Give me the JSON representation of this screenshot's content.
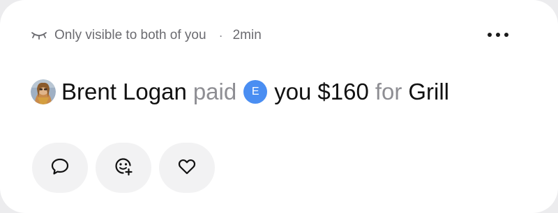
{
  "header": {
    "visibility_icon": "eye-closed-icon",
    "visibility_text": "Only visible to both of you",
    "separator": "·",
    "time": "2min",
    "more_icon": "more-horizontal-icon"
  },
  "story": {
    "avatar_icon": "user-photo-avatar",
    "payer": "Brent Logan",
    "verb": "paid",
    "recipient_initial": "E",
    "recipient": "you",
    "amount": "$160",
    "connector": "for",
    "note": "Grill",
    "badge_color": "#4a8ef2"
  },
  "actions": [
    {
      "icon": "comment-icon"
    },
    {
      "icon": "emoji-react-icon"
    },
    {
      "icon": "heart-icon"
    }
  ]
}
